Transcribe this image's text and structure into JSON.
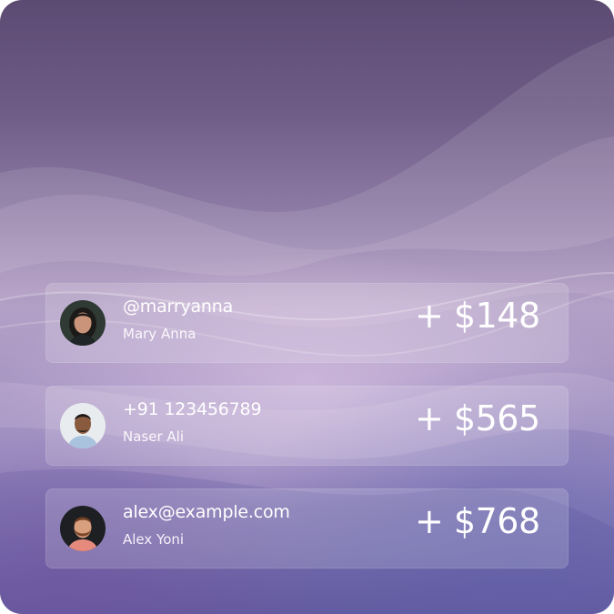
{
  "transactions": [
    {
      "handle": "@marryanna",
      "name": "Mary Anna",
      "amount": "+ $148",
      "avatar": "woman-portrait-avatar"
    },
    {
      "handle": "+91 123456789",
      "name": "Naser Ali",
      "amount": "+ $565",
      "avatar": "man-portrait-avatar"
    },
    {
      "handle": "alex@example.com",
      "name": "Alex Yoni",
      "amount": "+ $768",
      "avatar": "bearded-man-portrait-avatar"
    }
  ],
  "colors": {
    "text": "#ffffff",
    "background_top": "#5b4a72",
    "background_mid": "#b3a0c6",
    "background_bottom": "#6a5fa2"
  }
}
